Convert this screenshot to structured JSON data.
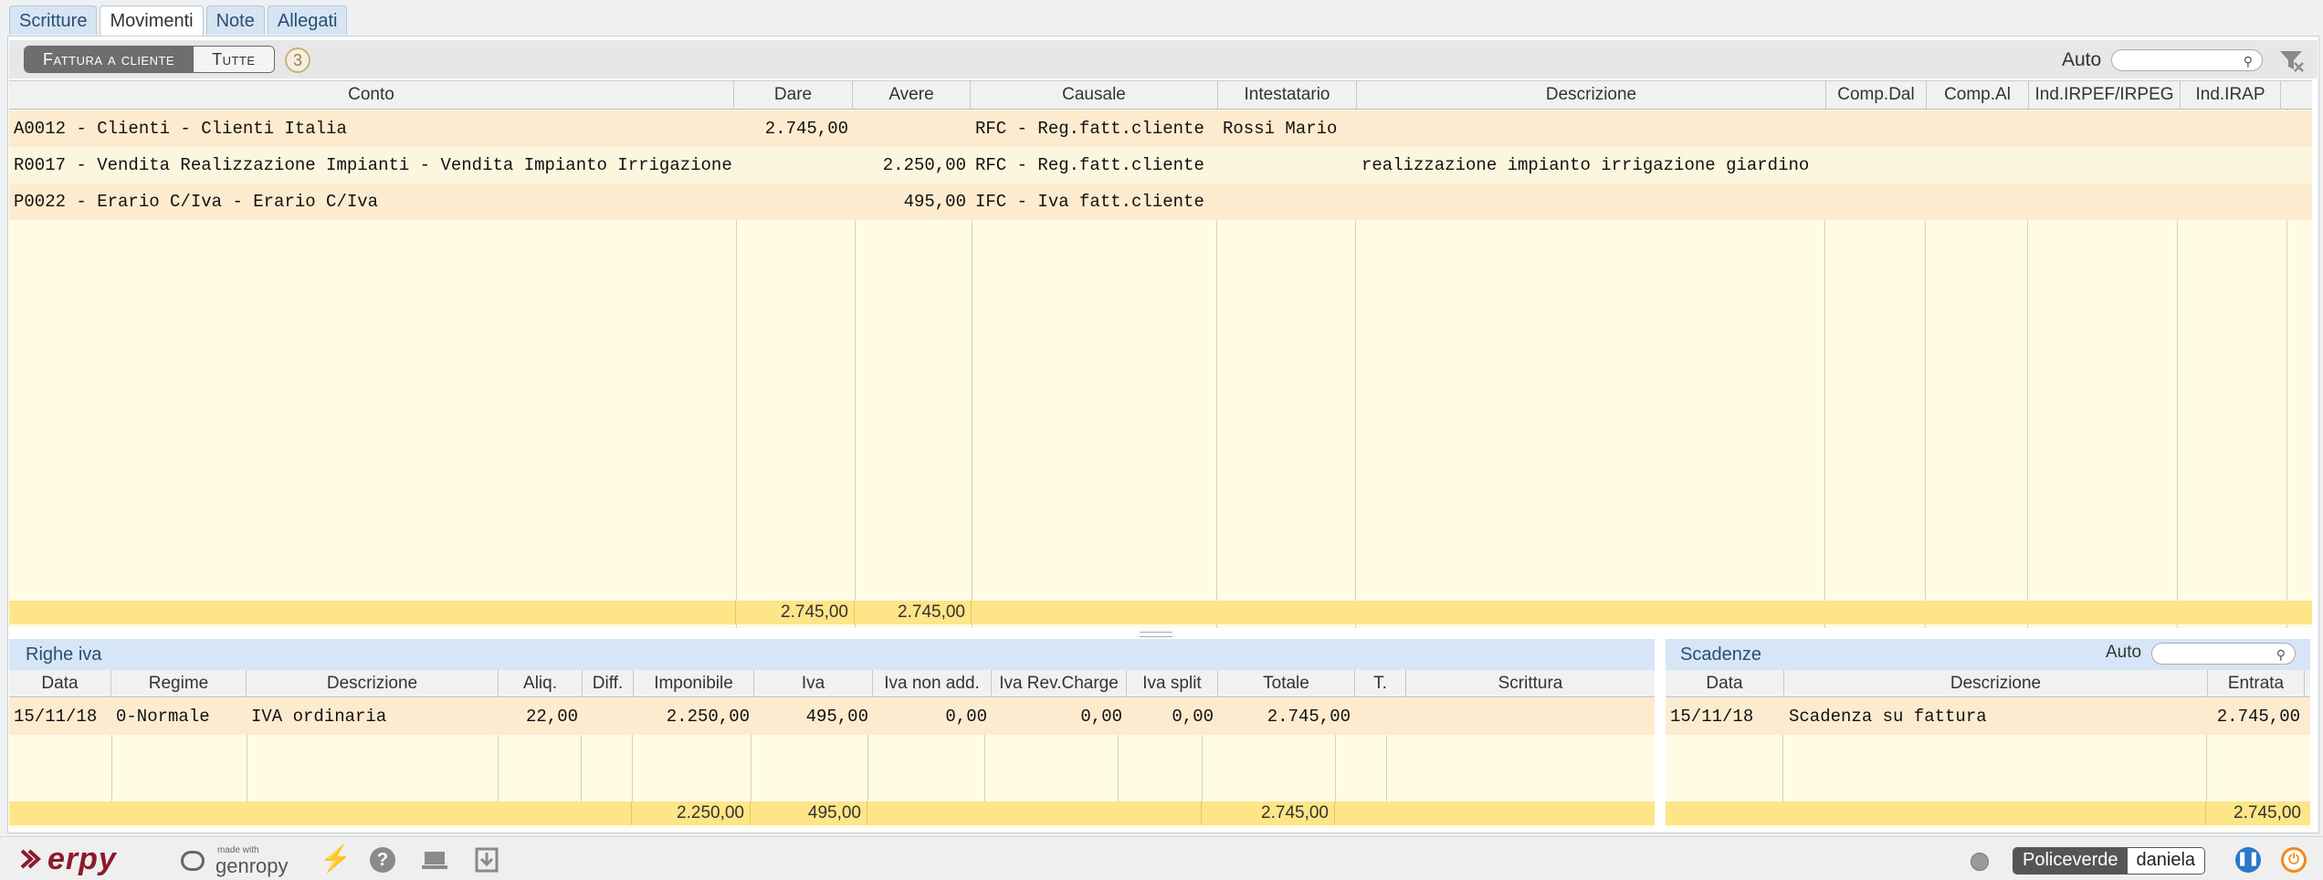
{
  "tabs": [
    "Scritture",
    "Movimenti",
    "Note",
    "Allegati"
  ],
  "active_tab": "Movimenti",
  "toolbar": {
    "filter_active": "Fattura a cliente",
    "filter_all": "Tutte",
    "count": "3",
    "auto_label": "Auto",
    "search_value": ""
  },
  "movimenti": {
    "columns": [
      "Conto",
      "Dare",
      "Avere",
      "Causale",
      "Intestatario",
      "Descrizione",
      "Comp.Dal",
      "Comp.Al",
      "Ind.IRPEF/IRPEG",
      "Ind.IRAP"
    ],
    "rows": [
      {
        "conto": "A0012 - Clienti - Clienti Italia",
        "dare": "2.745,00",
        "avere": "",
        "causale": "RFC - Reg.fatt.cliente",
        "intestatario": "Rossi Mario",
        "descrizione": ""
      },
      {
        "conto": "R0017 - Vendita Realizzazione Impianti - Vendita Impianto Irrigazione",
        "dare": "",
        "avere": "2.250,00",
        "causale": "RFC - Reg.fatt.cliente",
        "intestatario": "",
        "descrizione": "realizzazione impianto irrigazione giardino"
      },
      {
        "conto": "P0022 - Erario C/Iva - Erario C/Iva",
        "dare": "",
        "avere": "495,00",
        "causale": "IFC - Iva fatt.cliente",
        "intestatario": "",
        "descrizione": ""
      }
    ],
    "totals": {
      "dare": "2.745,00",
      "avere": "2.745,00"
    }
  },
  "righe_iva": {
    "title": "Righe iva",
    "columns": [
      "Data",
      "Regime",
      "Descrizione",
      "Aliq.",
      "Diff.",
      "Imponibile",
      "Iva",
      "Iva non add.",
      "Iva Rev.Charge",
      "Iva split",
      "Totale",
      "T.",
      "Scrittura"
    ],
    "rows": [
      {
        "data": "15/11/18",
        "regime": "0-Normale",
        "descrizione": "IVA ordinaria",
        "aliq": "22,00",
        "diff": "",
        "imponibile": "2.250,00",
        "iva": "495,00",
        "iva_non_add": "0,00",
        "iva_rev": "0,00",
        "iva_split": "0,00",
        "totale": "2.745,00",
        "t": "",
        "scrittura": ""
      }
    ],
    "totals": {
      "imponibile": "2.250,00",
      "iva": "495,00",
      "totale": "2.745,00"
    }
  },
  "scadenze": {
    "title": "Scadenze",
    "auto_label": "Auto",
    "columns": [
      "Data",
      "Descrizione",
      "Entrata"
    ],
    "rows": [
      {
        "data": "15/11/18",
        "descrizione": "Scadenza su fattura",
        "entrata": "2.745,00"
      }
    ],
    "totals": {
      "entrata": "2.745,00"
    }
  },
  "footer": {
    "brand": "erpy",
    "made_with": "made with",
    "framework": "genropy",
    "company": "Policeverde",
    "user": "daniela"
  },
  "colors": {
    "accent_blue": "#2a78c9",
    "power_orange": "#f08a16",
    "total_yellow": "#fde588"
  }
}
